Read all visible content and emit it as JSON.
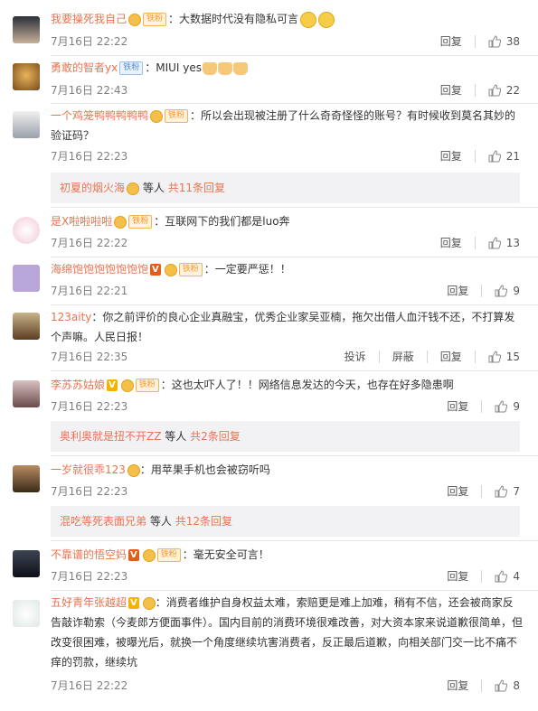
{
  "comments": [
    {
      "user": "我要操死我自己",
      "content": "：大数据时代没有隐私可言",
      "time": "7月16日 22:22",
      "reply": "回复",
      "likes": "38"
    },
    {
      "user": "勇敢的智者yx",
      "content": "：MIUI yes",
      "time": "7月16日 22:43",
      "reply": "回复",
      "likes": "22"
    },
    {
      "user": "一个鸡笼鸭鸭鸭鸭鸭",
      "content": "：所以会出现被注册了什么奇奇怪怪的账号？有时候收到莫名其妙的验证码？",
      "time": "7月16日 22:23",
      "reply": "回复",
      "likes": "21"
    },
    {
      "user": "是X啦啦啦啦",
      "content": "：互联网下的我们都是luo奔",
      "time": "7月16日 22:22",
      "reply": "回复",
      "likes": "13"
    },
    {
      "user": "海绵饱饱饱饱饱饱饱",
      "content": "：一定要严惩！！",
      "time": "7月16日 22:21",
      "reply": "回复",
      "likes": "9"
    },
    {
      "user": "123aity",
      "content": "：你之前评价的良心企业真融宝，优秀企业家吴亚楠，拖欠出借人血汗钱不还，不打算发个声嘛。人民日报！",
      "time": "7月16日 22:35",
      "report": "投诉",
      "block": "屏蔽",
      "reply": "回复",
      "likes": "15"
    },
    {
      "user": "李苏苏姑娘",
      "content": "：这也太吓人了！！网络信息发达的今天，也存在好多隐患啊",
      "time": "7月16日 22:23",
      "reply": "回复",
      "likes": "9"
    },
    {
      "user": "一岁就很乖123",
      "content": "：用苹果手机也会被窃听吗",
      "time": "7月16日 22:23",
      "reply": "回复",
      "likes": "7"
    },
    {
      "user": "不靠谱的悟空妈",
      "content": "：毫无安全可言！",
      "time": "7月16日 22:23",
      "reply": "回复",
      "likes": "4"
    },
    {
      "user": "五好青年张越超",
      "content": "：消费者维护自身权益太难，索赔更是难上加难，稍有不信，还会被商家反告敲诈勒索（今麦郎方便面事件）。国内目前的消费环境很难改善，对大资本家来说道歉很简单，但改变很困难，被曝光后，就换一个角度继续坑害消费者，反正最后道歉，向相关部门交一比不痛不痒的罚款，继续坑",
      "time": "7月16日 22:22",
      "reply": "回复",
      "likes": "8"
    }
  ],
  "threads": [
    {
      "user": "初夏的烟火海",
      "mid": "等人",
      "count": "共11条回复"
    },
    {
      "user": "奥利奥就是扭不开ZZ",
      "mid": "等人",
      "count": "共2条回复"
    },
    {
      "user": "混吃等死表面兄弟",
      "mid": "等人",
      "count": "共12条回复"
    }
  ],
  "badges": {
    "fan": "铁粉"
  },
  "colors": {
    "username": "#eb7350",
    "meta": "#808080",
    "thread_bg": "#f2f2f5"
  }
}
